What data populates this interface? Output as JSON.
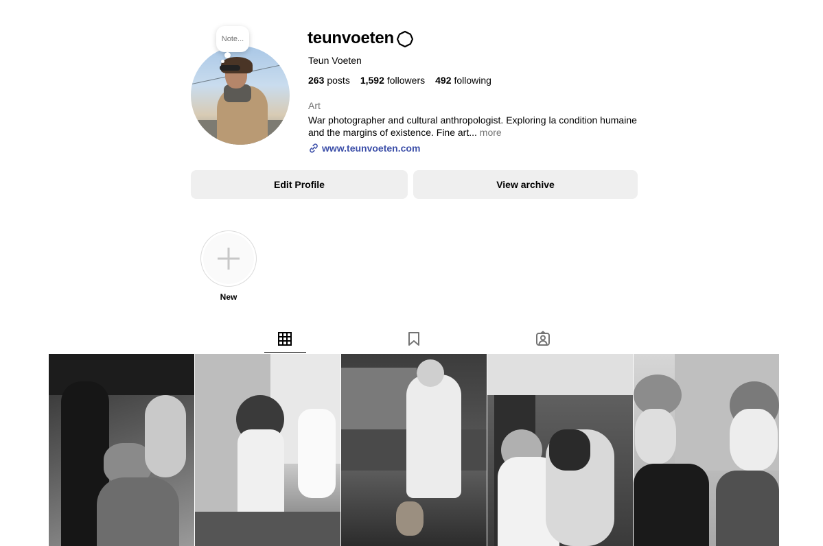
{
  "profile": {
    "note_text": "Note...",
    "username": "teunvoeten",
    "full_name": "Teun Voeten",
    "stats": {
      "posts_count": "263",
      "posts_label": "posts",
      "followers_count": "1,592",
      "followers_label": "followers",
      "following_count": "492",
      "following_label": "following"
    },
    "category": "Art",
    "bio": "War photographer and cultural anthropologist. Exploring la condition humaine and the margins of existence. Fine art...",
    "more_label": "more",
    "website": "www.teunvoeten.com"
  },
  "actions": {
    "edit_profile_label": "Edit Profile",
    "view_archive_label": "View archive"
  },
  "highlights": {
    "new_label": "New"
  },
  "tabs": {
    "icons": [
      "grid-icon",
      "bookmark-icon",
      "tagged-icon"
    ],
    "active": "grid-icon"
  },
  "posts": {
    "count_visible": 5,
    "style": "black-and-white photographs"
  },
  "colors": {
    "link": "#3b4ea8",
    "button_bg": "#efefef",
    "secondary_text": "#737373"
  }
}
